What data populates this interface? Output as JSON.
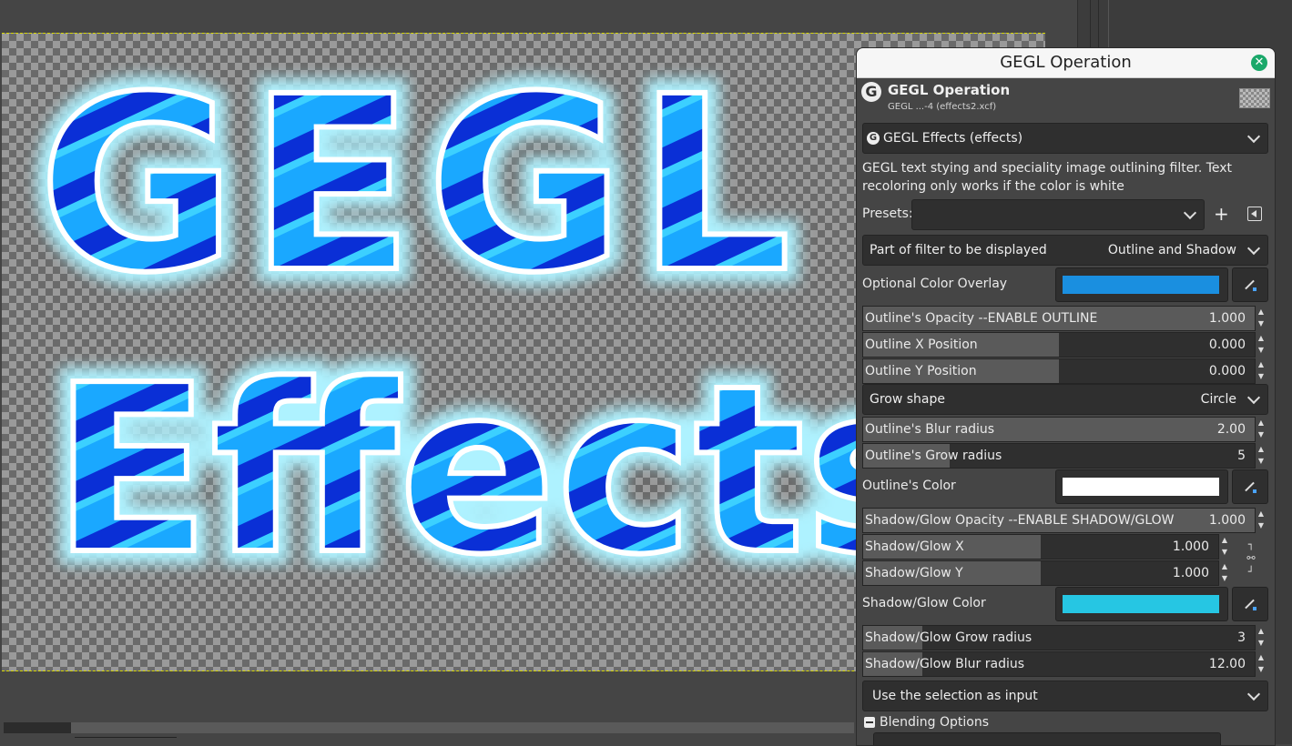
{
  "canvas": {
    "text_line1": "GEGL",
    "text_line2": "Effects"
  },
  "dialog": {
    "window_title": "GEGL Operation",
    "header_title": "GEGL Operation",
    "header_subtitle": "GEGL ...-4 (effects2.xcf)",
    "operation": "GEGL Effects (effects)",
    "description": "GEGL text stying and speciality image outlining filter. Text recoloring only works if the color is white",
    "presets_label": "Presets:",
    "presets_value": "",
    "part_label": "Part of filter to be displayed",
    "part_value": "Outline and Shadow",
    "color_overlay_label": "Optional Color Overlay",
    "color_overlay": "#1a8fe0",
    "outline_opacity": {
      "label": "Outline's Opacity --ENABLE OUTLINE",
      "value": "1.000",
      "fill": 1.0
    },
    "outline_x": {
      "label": "Outline X Position",
      "value": "0.000",
      "fill": 0.5
    },
    "outline_y": {
      "label": "Outline Y Position",
      "value": "0.000",
      "fill": 0.5
    },
    "grow_shape_label": "Grow shape",
    "grow_shape_value": "Circle",
    "outline_blur": {
      "label": "Outline's Blur radius",
      "value": "2.00",
      "fill": 1.0
    },
    "outline_grow": {
      "label": "Outline's Grow radius",
      "value": "5",
      "fill": 0.22
    },
    "outline_color_label": "Outline's Color",
    "outline_color": "#ffffff",
    "shadow_opacity": {
      "label": "Shadow/Glow Opacity --ENABLE SHADOW/GLOW",
      "value": "1.000",
      "fill": 1.0
    },
    "shadow_x": {
      "label": "Shadow/Glow X",
      "value": "1.000",
      "fill": 0.5
    },
    "shadow_y": {
      "label": "Shadow/Glow Y",
      "value": "1.000",
      "fill": 0.5
    },
    "shadow_color_label": "Shadow/Glow Color",
    "shadow_color": "#26c6e3",
    "shadow_grow": {
      "label": "Shadow/Glow Grow radius",
      "value": "3",
      "fill": 0.15
    },
    "shadow_blur": {
      "label": "Shadow/Glow Blur radius",
      "value": "12.00",
      "fill": 0.15
    },
    "input_mode": "Use the selection as input",
    "blending_label": "Blending Options"
  },
  "icons": [
    "gegl-logo-icon",
    "close-icon",
    "chevron-down-icon",
    "plus-icon",
    "menu-icon",
    "color-picker-icon",
    "chain-link-icon",
    "collapse-icon"
  ]
}
